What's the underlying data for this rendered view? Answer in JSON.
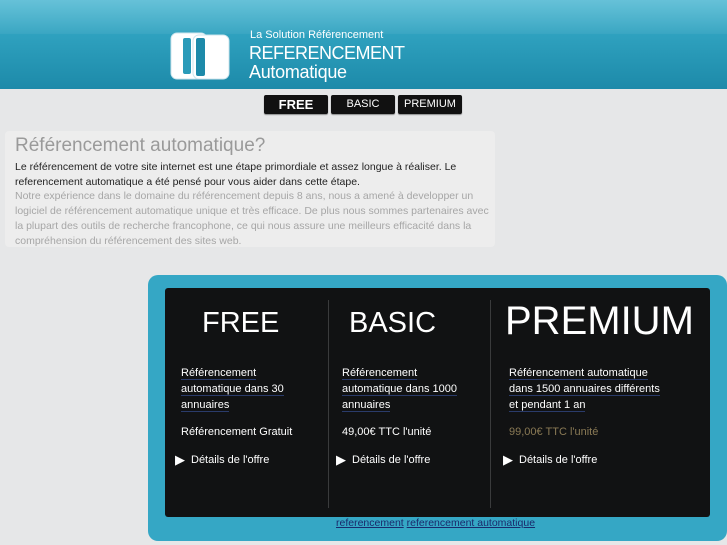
{
  "header": {
    "tagline": "La Solution Référencement",
    "brand_line1": "REFERENCEMENT",
    "brand_line2": "Automatique"
  },
  "nav": {
    "free": "FREE",
    "basic": "BASIC",
    "premium": "PREMIUM"
  },
  "intro": {
    "title": "Référencement automatique?",
    "paragraph1": "Le référencement de votre site internet est une étape primordiale et assez longue à réaliser. Le referencement automatique a été pensé pour vous aider dans cette étape.",
    "paragraph2": "Notre expérience dans le domaine du référencement depuis 8 ans, nous a amené à developper un logiciel de référencement automatique unique et très efficace. De plus nous sommes partenaires avec la plupart des outils de recherche francophone, ce qui nous assure une meilleurs efficacité dans la compréhension du référencement des sites web."
  },
  "offers": [
    {
      "title": "FREE",
      "desc_lines": [
        "Référencement",
        "automatique dans 30",
        "annuaires"
      ],
      "price": "Référencement Gratuit",
      "price_color": "#ffffff",
      "details": "Détails de l'offre"
    },
    {
      "title": "BASIC",
      "desc_lines": [
        "Référencement",
        "automatique dans 1000",
        "annuaires"
      ],
      "price": "49,00€ TTC l'unité",
      "price_color": "#ffffff",
      "details": "Détails de l'offre"
    },
    {
      "title": "PREMIUM",
      "desc_lines": [
        "Référencement automatique",
        "dans 1500 annuaires différents",
        "et pendant 1 an"
      ],
      "price": "99,00€ TTC l'unité",
      "price_color": "#8a7a55",
      "details": "Détails de l'offre"
    }
  ],
  "footer": {
    "link1": "referencement",
    "link2": "referencement automatique"
  },
  "colors": {
    "header_blue": "#2a9bb9",
    "frame_blue": "#35a7c5",
    "panel_dark": "#111213"
  }
}
